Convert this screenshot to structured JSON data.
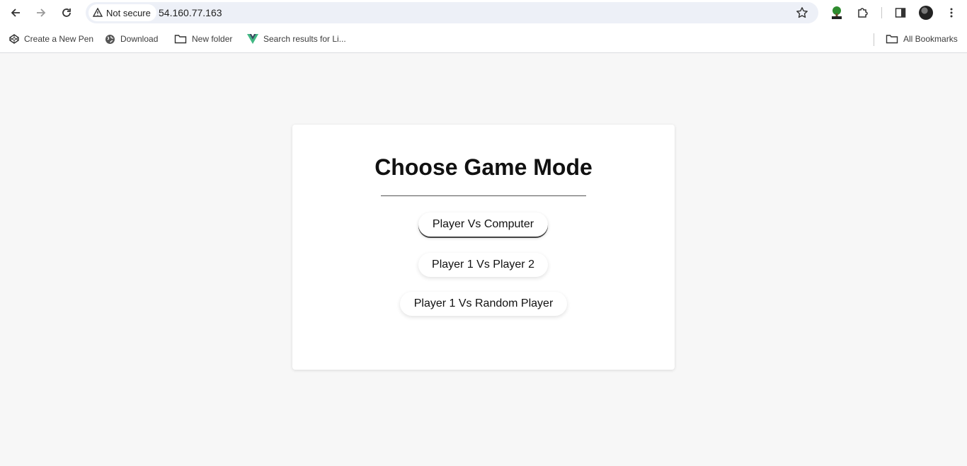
{
  "browser": {
    "security_label": "Not secure",
    "url": "54.160.77.163",
    "icons": [
      "back-icon",
      "forward-icon",
      "reload-icon",
      "warning-icon",
      "star-icon",
      "html-extension-icon",
      "extensions-icon",
      "side-panel-icon",
      "avatar",
      "more-icon"
    ]
  },
  "bookmarks": {
    "items": [
      {
        "label": "Create a New Pen",
        "icon": "codepen-icon"
      },
      {
        "label": "Download",
        "icon": "globe-icon"
      },
      {
        "label": "New folder",
        "icon": "folder-icon"
      },
      {
        "label": "Search results for Li...",
        "icon": "vue-icon"
      }
    ],
    "all_bookmarks": "All Bookmarks"
  },
  "game": {
    "title": "Choose Game Mode",
    "modes": [
      {
        "label": "Player Vs Computer"
      },
      {
        "label": "Player 1 Vs Player 2"
      },
      {
        "label": "Player 1 Vs Random Player"
      }
    ]
  },
  "colors": {
    "page_background": "#f7f7f7",
    "card_background": "#ffffff",
    "omnibox_background": "#edf0f7"
  }
}
